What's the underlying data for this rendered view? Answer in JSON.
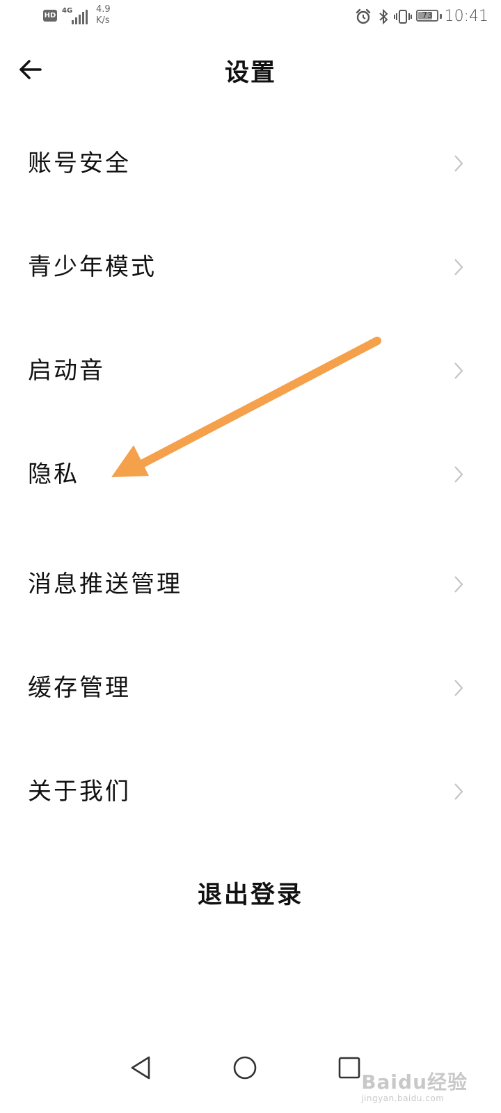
{
  "status_bar": {
    "hd": "HD",
    "network": "4G",
    "speed_value": "4.9",
    "speed_unit": "K/s",
    "battery": "73",
    "time": "10:41"
  },
  "header": {
    "title": "设置"
  },
  "settings": {
    "items": [
      {
        "label": "账号安全"
      },
      {
        "label": "青少年模式"
      },
      {
        "label": "启动音"
      },
      {
        "label": "隐私"
      },
      {
        "label": "消息推送管理"
      },
      {
        "label": "缓存管理"
      },
      {
        "label": "关于我们"
      }
    ]
  },
  "logout_label": "退出登录",
  "annotation": {
    "color": "#F5A04A"
  },
  "watermark": {
    "main": "Baidu经验",
    "sub": "jingyan.baidu.com"
  },
  "icons": [
    "back-arrow-icon",
    "chevron-right-icon",
    "nav-back-icon",
    "nav-home-icon",
    "nav-recents-icon",
    "alarm-icon",
    "bluetooth-icon",
    "vibrate-icon"
  ]
}
